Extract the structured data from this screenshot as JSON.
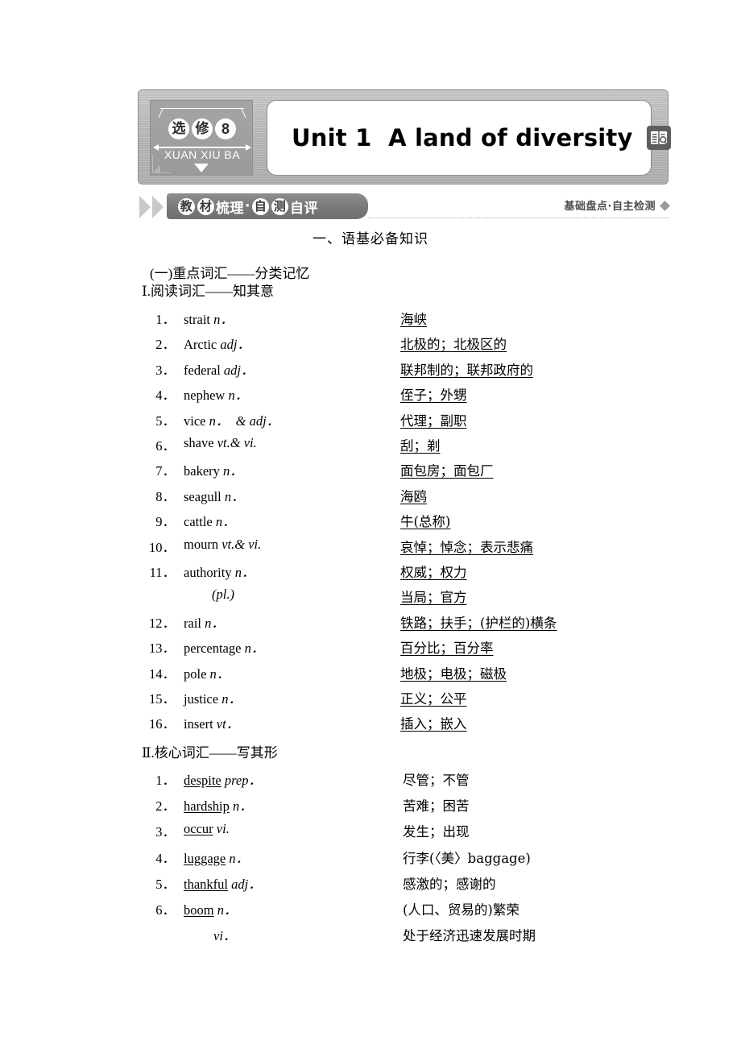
{
  "header": {
    "badge": {
      "chars": [
        "选",
        "修"
      ],
      "number": "8",
      "pinyin": "XUAN XIU BA"
    },
    "unit_title": "Unit 1  A land of diversity",
    "book_icon": "book-search-icon"
  },
  "banner": {
    "title_parts": [
      {
        "text": "教",
        "circled": true
      },
      {
        "text": "材",
        "circled": true
      },
      {
        "text": "梳理",
        "circled": false
      },
      {
        "text": "·",
        "circled": false
      },
      {
        "text": "自",
        "circled": true
      },
      {
        "text": "测",
        "circled": true
      },
      {
        "text": "自评",
        "circled": false
      }
    ],
    "right_label": "基础盘点·自主检测"
  },
  "headings": {
    "main": "一、语基必备知识",
    "sub_a": "(一)重点词汇——分类记忆",
    "section_1": "Ⅰ.阅读词汇——知其意",
    "section_2": "Ⅱ.核心词汇——写其形"
  },
  "reading_vocab": [
    {
      "num": "1．",
      "word": "strait",
      "pos": "n．",
      "def": "海峡"
    },
    {
      "num": "2．",
      "word": "Arctic",
      "pos": "adj．",
      "def": "北极的；北极区的"
    },
    {
      "num": "3．",
      "word": "federal",
      "pos": "adj．",
      "def": "联邦制的；联邦政府的"
    },
    {
      "num": "4．",
      "word": "nephew",
      "pos": "n．",
      "def": "侄子；外甥"
    },
    {
      "num": "5．",
      "word": "vice",
      "pos": "n．  & adj．",
      "def": "代理；副职"
    },
    {
      "num": "6．",
      "word": "shave",
      "pos": "vt.& vi.",
      "def": "刮；剃"
    },
    {
      "num": "7．",
      "word": "bakery",
      "pos": "n．",
      "def": "面包房；面包厂"
    },
    {
      "num": "8．",
      "word": "seagull",
      "pos": "n．",
      "def": "海鸥"
    },
    {
      "num": "9．",
      "word": "cattle",
      "pos": "n．",
      "def": "牛(总称)"
    },
    {
      "num": "10．",
      "word": "mourn",
      "pos": "vt.& vi.",
      "def": "哀悼；悼念；表示悲痛"
    },
    {
      "num": "11．",
      "word": "authority",
      "pos": "n．",
      "def": "权威；权力"
    },
    {
      "num": "",
      "word": "",
      "pos": "(pl.)",
      "def": "当局；官方",
      "is_sub": true
    },
    {
      "num": "12．",
      "word": "rail",
      "pos": "n．",
      "def": "铁路；扶手；(护栏的)横条"
    },
    {
      "num": "13．",
      "word": "percentage",
      "pos": "n．",
      "def": "百分比；百分率"
    },
    {
      "num": "14．",
      "word": "pole",
      "pos": "n．",
      "def": "地极；电极；磁极"
    },
    {
      "num": "15．",
      "word": "justice",
      "pos": "n．",
      "def": "正义；公平"
    },
    {
      "num": "16．",
      "word": "insert",
      "pos": "vt．",
      "def": "插入；嵌入"
    }
  ],
  "core_vocab": [
    {
      "num": "1．",
      "word": "despite",
      "pos": "prep．",
      "def": "尽管；不管"
    },
    {
      "num": "2．",
      "word": "hardship",
      "pos": "n．",
      "def": "苦难；困苦"
    },
    {
      "num": "3．",
      "word": "occur",
      "pos": "vi.",
      "def": "发生；出现"
    },
    {
      "num": "4．",
      "word": "luggage",
      "pos": "n．",
      "def": "行李(〈美〉baggage)"
    },
    {
      "num": "5．",
      "word": "thankful",
      "pos": "adj．",
      "def": "感激的；感谢的"
    },
    {
      "num": "6．",
      "word": "boom",
      "pos": "n．",
      "def": "(人口、贸易的)繁荣"
    },
    {
      "num": "",
      "word": "",
      "pos": "vi．",
      "def": "处于经济迅速发展时期",
      "is_sub": true
    }
  ]
}
